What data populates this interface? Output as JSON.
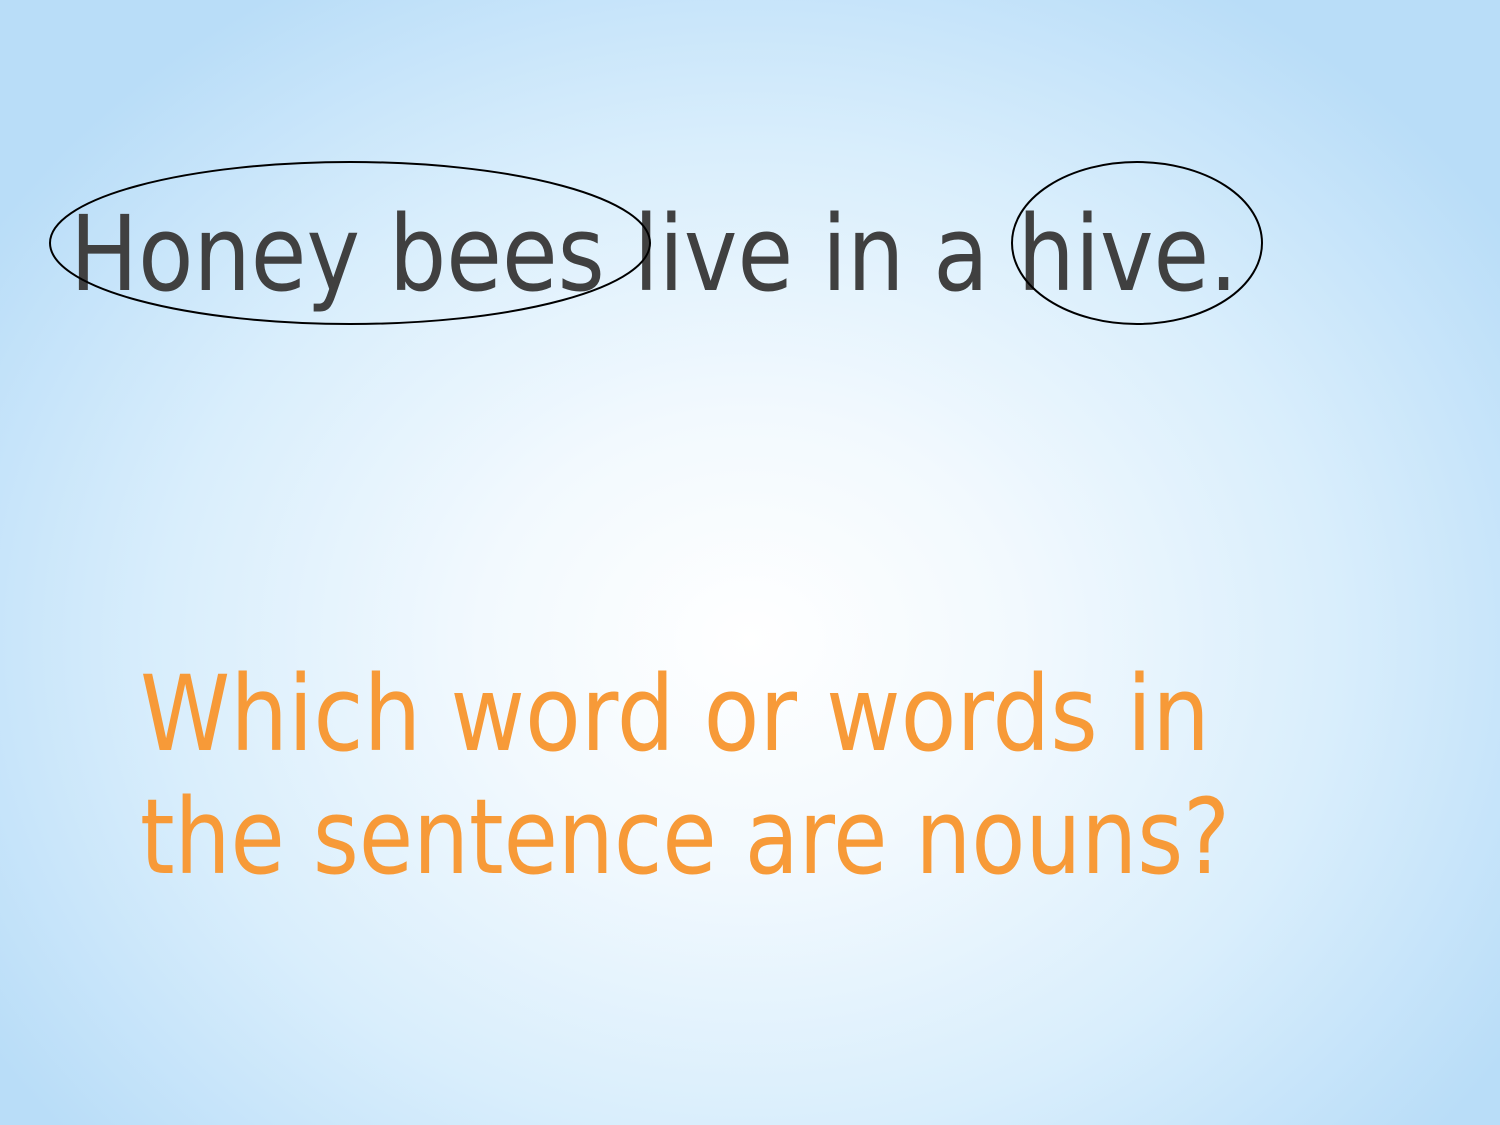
{
  "slide": {
    "sentence": "Honey bees live in a hive.",
    "question_line1": "Which word or words in",
    "question_line2": "the sentence are nouns?",
    "colors": {
      "sentence": "#404040",
      "question": "#F79A38",
      "circle": "#000000"
    }
  }
}
